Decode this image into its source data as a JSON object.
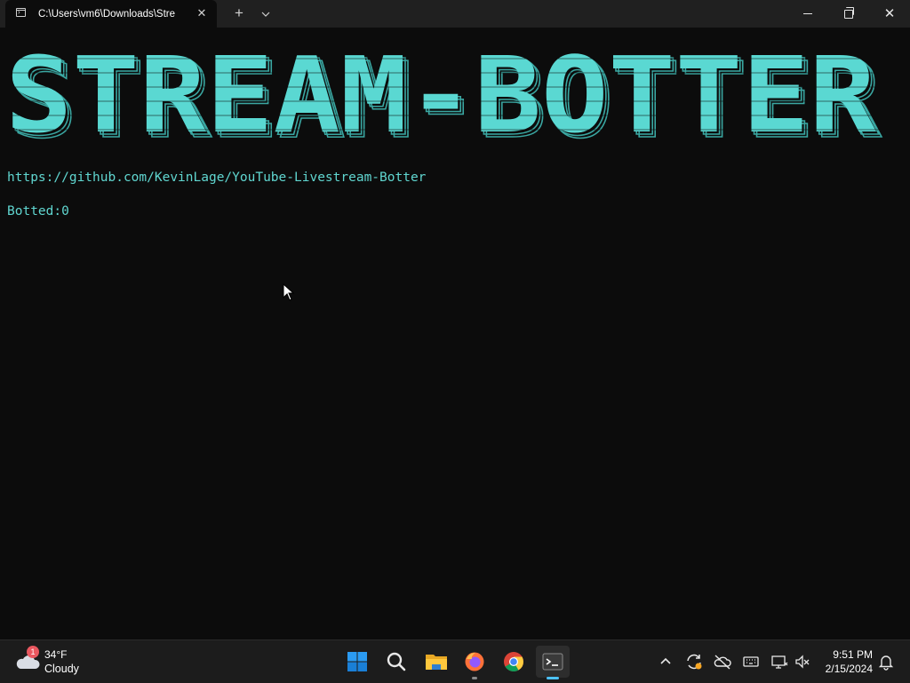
{
  "window": {
    "tab_title": "C:\\Users\\vm6\\Downloads\\Stre",
    "tab_close": "✕",
    "new_tab": "+",
    "tab_dropdown": "⌄",
    "close": "✕"
  },
  "terminal": {
    "banner_text": "STREAM-BOTTER",
    "repo_url": "https://github.com/KevinLage/YouTube-Livestream-Botter",
    "botted_line": "Botted:0",
    "accent_color": "#60d6d0"
  },
  "taskbar": {
    "weather": {
      "badge": "1",
      "temperature": "34°F",
      "condition": "Cloudy",
      "icon": "cloud-icon"
    },
    "apps": [
      {
        "name": "start",
        "icon": "windows-logo-icon"
      },
      {
        "name": "search",
        "icon": "search-icon"
      },
      {
        "name": "file-explorer",
        "icon": "folder-icon"
      },
      {
        "name": "firefox",
        "icon": "firefox-icon"
      },
      {
        "name": "chrome",
        "icon": "chrome-icon"
      },
      {
        "name": "terminal",
        "icon": "terminal-icon",
        "active": true
      }
    ],
    "tray_icons": [
      "chevron-up-icon",
      "sync-icon",
      "cloud-offline-icon",
      "keyboard-icon",
      "network-icon",
      "volume-muted-icon",
      "bell-icon"
    ],
    "clock": {
      "time": "9:51 PM",
      "date": "2/15/2024"
    }
  }
}
